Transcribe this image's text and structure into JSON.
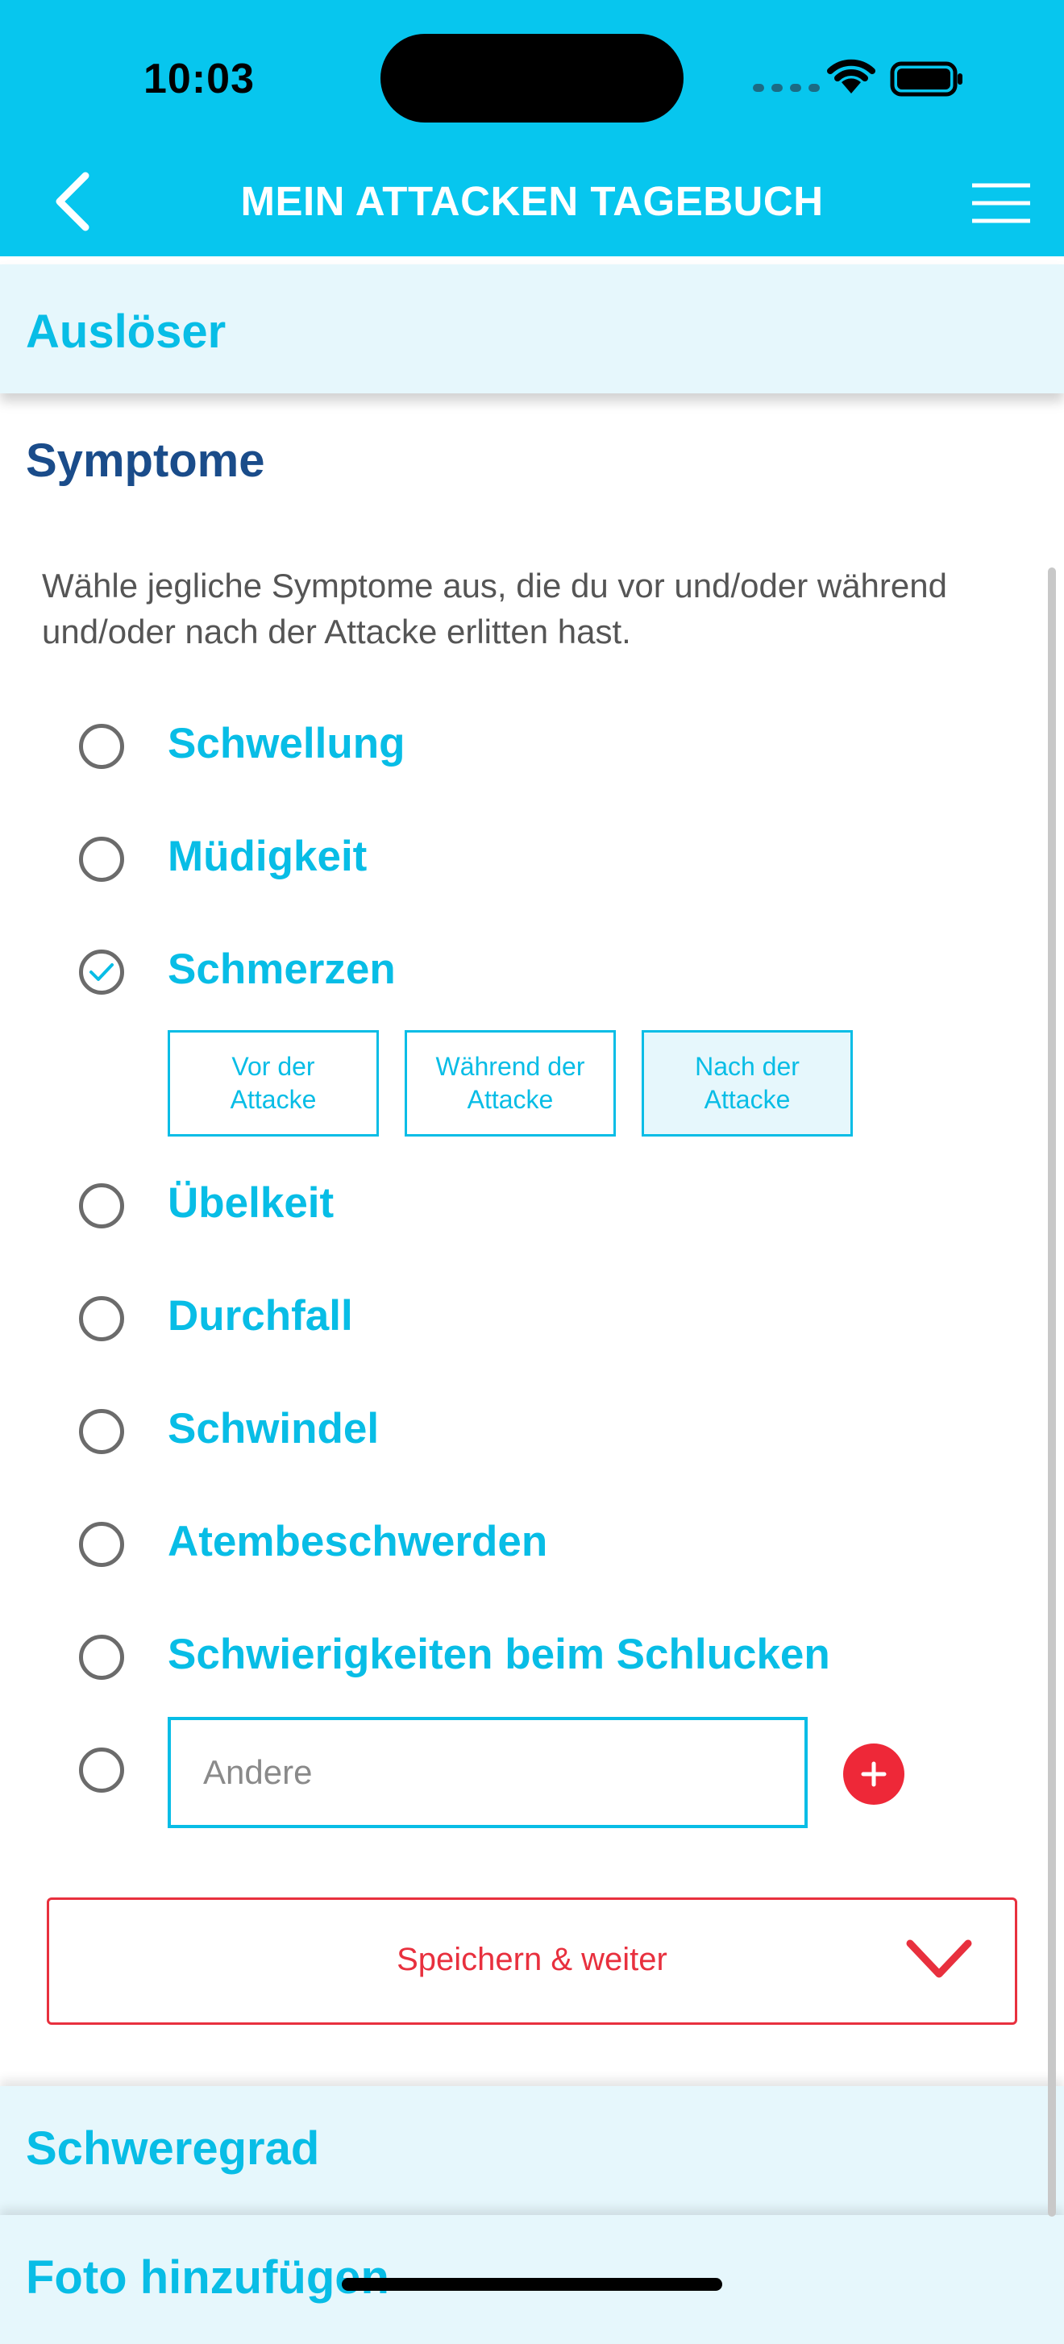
{
  "status_bar": {
    "time": "10:03"
  },
  "header": {
    "title": "MEIN ATTACKEN TAGEBUCH"
  },
  "sections": {
    "ausloeser": "Auslöser",
    "schweregrad": "Schweregrad",
    "foto": "Foto hinzufügen"
  },
  "symptome": {
    "title": "Symptome",
    "description": "Wähle jegliche Symptome aus, die du vor und/oder während und/oder nach der Attacke erlitten hast.",
    "items": [
      {
        "label": "Schwellung",
        "checked": false
      },
      {
        "label": "Müdigkeit",
        "checked": false
      },
      {
        "label": "Schmerzen",
        "checked": true
      },
      {
        "label": "Übelkeit",
        "checked": false
      },
      {
        "label": "Durchfall",
        "checked": false
      },
      {
        "label": "Schwindel",
        "checked": false
      },
      {
        "label": "Atembeschwerden",
        "checked": false
      },
      {
        "label": "Schwierigkeiten beim Schlucken",
        "checked": false
      }
    ],
    "timing_options": [
      {
        "line1": "Vor der",
        "line2": "Attacke",
        "selected": false
      },
      {
        "line1": "Während der",
        "line2": "Attacke",
        "selected": false
      },
      {
        "line1": "Nach der",
        "line2": "Attacke",
        "selected": true
      }
    ],
    "other_placeholder": "Andere",
    "other_value": ""
  },
  "save_button": {
    "label": "Speichern & weiter"
  },
  "colors": {
    "header_bg": "#07c6ee",
    "accent": "#08bde6",
    "title_dark": "#1a4c8a",
    "danger": "#e8303e",
    "section_bg": "#e6f7fc"
  }
}
